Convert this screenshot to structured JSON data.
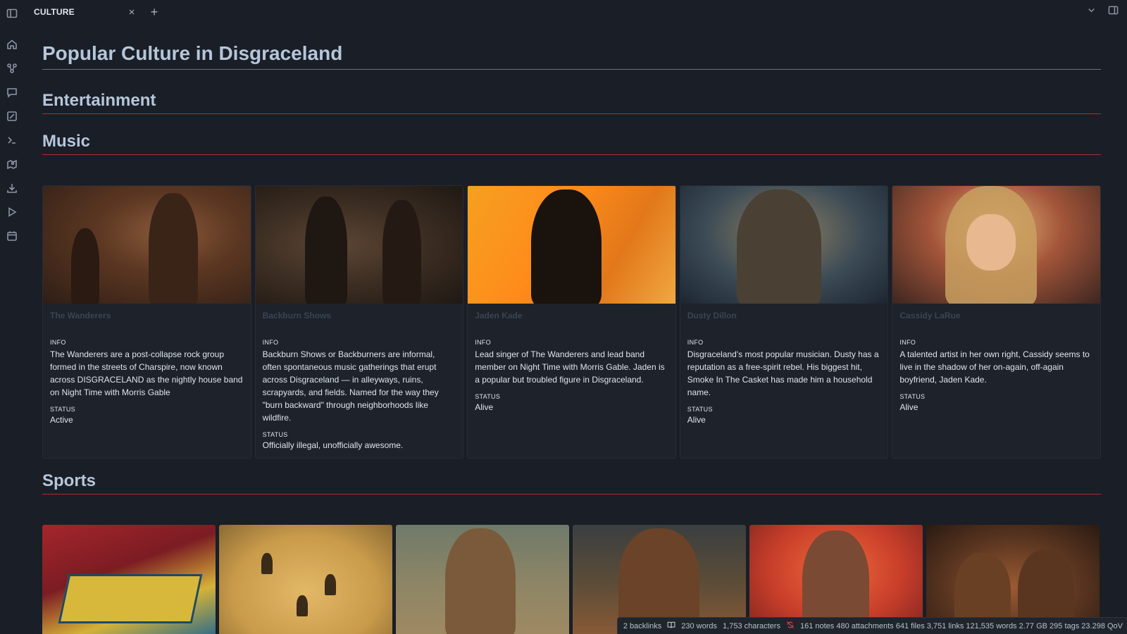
{
  "tab": {
    "title": "CULTURE",
    "close": "×",
    "new": "+"
  },
  "page": {
    "title": "Popular Culture in Disgraceland"
  },
  "sections": {
    "entertainment": "Entertainment",
    "music": "Music",
    "sports": "Sports"
  },
  "labels": {
    "info": "INFO",
    "status": "STATUS"
  },
  "music_cards": [
    {
      "name": "The Wanderers",
      "info": "The Wanderers are a post-collapse rock group formed in the streets of Charspire, now known across DISGRACELAND as the nightly house band on Night Time with Morris Gable",
      "status": "Active"
    },
    {
      "name": "Backburn Shows",
      "info": "Backburn Shows or Backburners are informal, often spontaneous music gatherings that erupt across Disgraceland — in alleyways, ruins, scrapyards, and fields. Named for the way they \"burn backward\" through neighborhoods like wildfire.",
      "status": "Officially illegal, unofficially awesome."
    },
    {
      "name": "Jaden Kade",
      "info": "Lead singer of The Wanderers and lead band member on Night Time with Morris Gable. Jaden is a popular but troubled figure in Disgraceland.",
      "status": "Alive"
    },
    {
      "name": "Dusty Dillon",
      "info": "Disgraceland's most popular musician. Dusty has a reputation as a free-spirit rebel. His biggest hit, Smoke In The Casket has made him a household name.",
      "status": "Alive"
    },
    {
      "name": "Cassidy LaRue",
      "info": "A talented artist in her own right, Cassidy seems to live in the shadow of her on-again, off-again boyfriend, Jaden Kade.",
      "status": "Alive"
    }
  ],
  "statusbar": {
    "backlinks": "2 backlinks",
    "words": "230 words",
    "characters": "1,753 characters",
    "vault": "161 notes 480 attachments 641 files 3,751 links 121,535 words 2.77 GB 295 tags 23.298 QoV"
  },
  "icons": [
    "sidebar-toggle-icon",
    "home-icon",
    "graph-icon",
    "chat-icon",
    "canvas-icon",
    "terminal-icon",
    "map-icon",
    "download-icon",
    "play-icon",
    "calendar-icon"
  ]
}
